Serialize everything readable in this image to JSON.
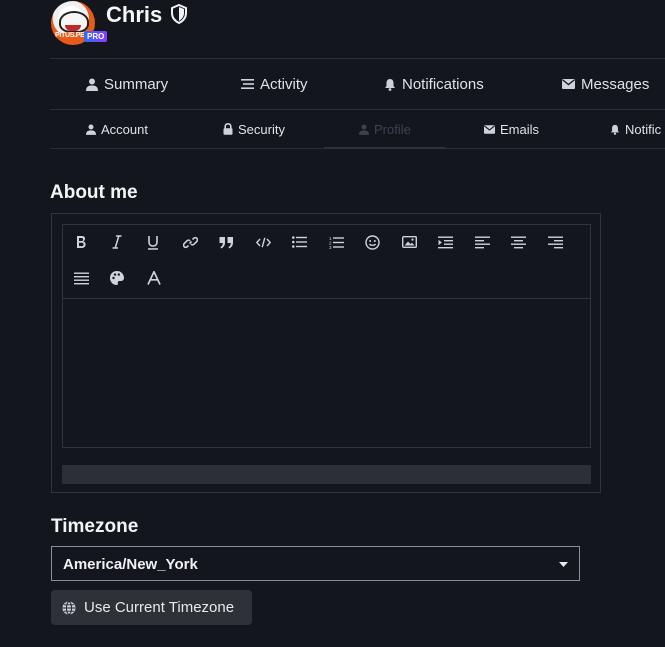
{
  "profile": {
    "username": "Chris",
    "avatar_text": "PITUS.PE",
    "badge": "PRO"
  },
  "tabs_primary": [
    {
      "label": "Summary",
      "icon": "user-icon"
    },
    {
      "label": "Activity",
      "icon": "list-icon"
    },
    {
      "label": "Notifications",
      "icon": "bell-icon"
    },
    {
      "label": "Messages",
      "icon": "envelope-icon"
    }
  ],
  "tabs_secondary": [
    {
      "label": "Account",
      "icon": "user-icon"
    },
    {
      "label": "Security",
      "icon": "lock-icon"
    },
    {
      "label": "Profile",
      "icon": "user-icon",
      "active": true
    },
    {
      "label": "Emails",
      "icon": "envelope-icon"
    },
    {
      "label": "Notific",
      "icon": "bell-icon"
    }
  ],
  "about": {
    "title": "About me",
    "toolbar": [
      "bold",
      "italic",
      "underline",
      "link",
      "quote",
      "code",
      "bulleted-list",
      "numbered-list",
      "emoji",
      "image",
      "indent",
      "align-left",
      "align-center",
      "align-right",
      "justify",
      "palette",
      "font"
    ],
    "content": ""
  },
  "timezone": {
    "title": "Timezone",
    "selected": "America/New_York",
    "use_current_label": "Use Current Timezone"
  },
  "colors": {
    "background": "#13161c",
    "border": "#2a2e36",
    "button": "#2e3137",
    "pro_badge": "#5a4cff",
    "active_tab": "#3a4250"
  }
}
